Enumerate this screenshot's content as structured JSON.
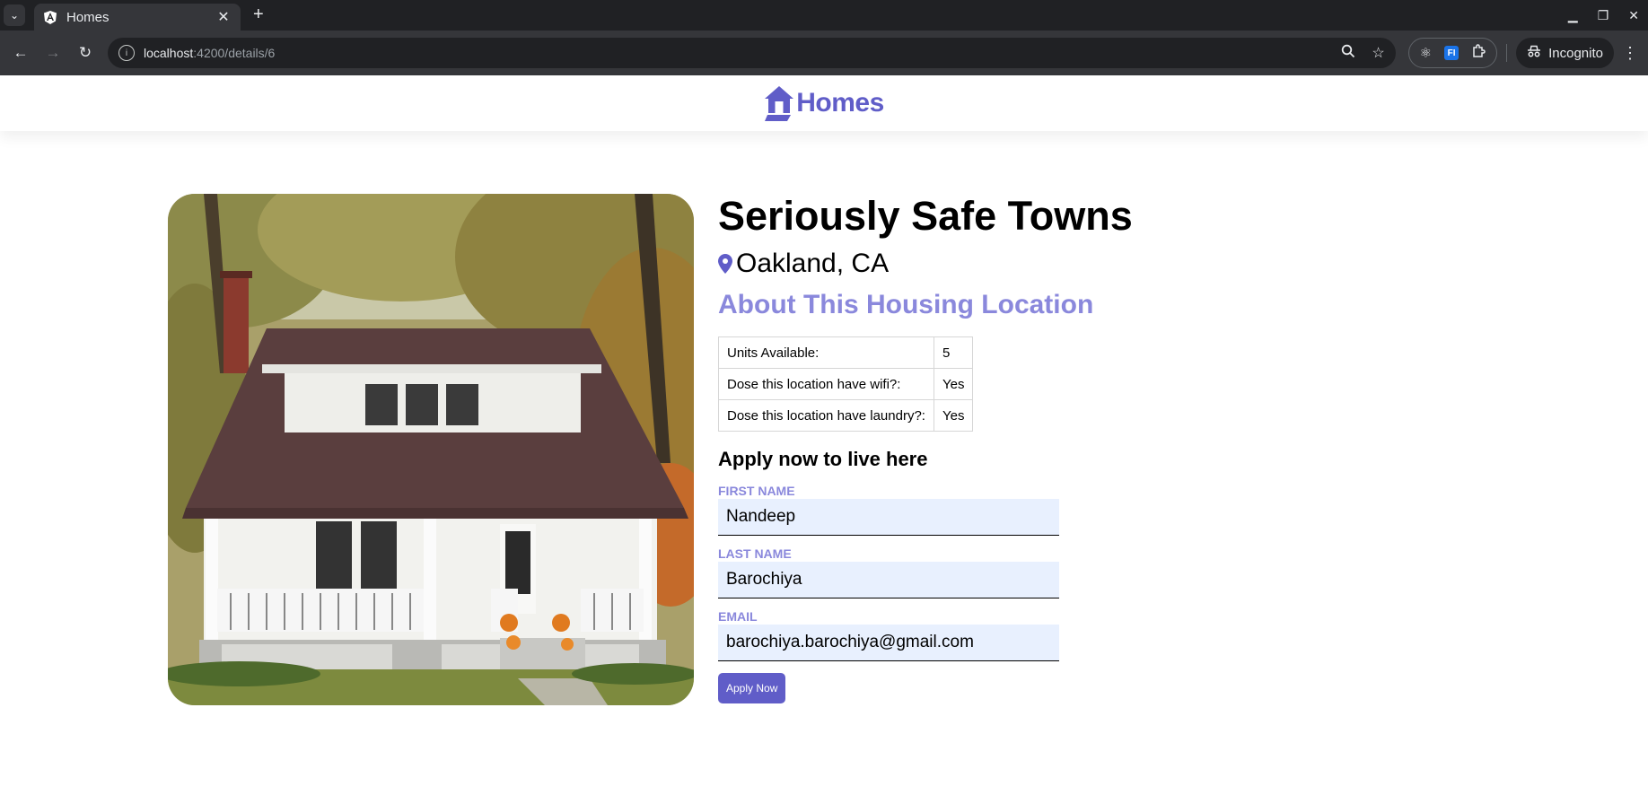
{
  "browser": {
    "tab_title": "Homes",
    "url_host": "localhost",
    "url_path": ":4200/details/6",
    "profile_label": "Incognito",
    "ext_fi_label": "FI"
  },
  "app": {
    "logo_text": "Homes",
    "brand_color": "#605DC8",
    "accent_color": "#8A88DC"
  },
  "listing": {
    "name": "Seriously Safe Towns",
    "location": "Oakland, CA",
    "about_heading": "About This Housing Location",
    "features": [
      {
        "label": "Units Available:",
        "value": "5"
      },
      {
        "label": "Dose this location have wifi?:",
        "value": "Yes"
      },
      {
        "label": "Dose this location have laundry?:",
        "value": "Yes"
      }
    ]
  },
  "apply": {
    "heading": "Apply now to live here",
    "first_name_label": "FIRST NAME",
    "first_name_value": "Nandeep",
    "last_name_label": "LAST NAME",
    "last_name_value": "Barochiya",
    "email_label": "EMAIL",
    "email_value": "barochiya.barochiya@gmail.com",
    "submit_label": "Apply Now"
  }
}
